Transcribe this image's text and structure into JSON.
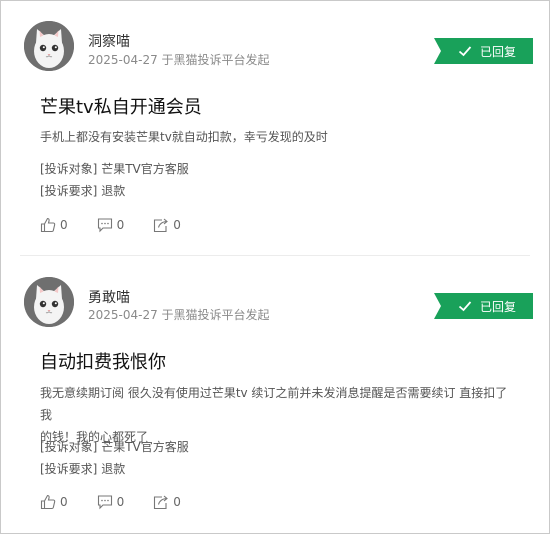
{
  "posts": [
    {
      "user": "洞察喵",
      "meta": "2025-04-27 于黑猫投诉平台发起",
      "status": "已回复",
      "title": "芒果tv私自开通会员",
      "description": "手机上都没有安装芒果tv就自动扣款，幸亏发现的及时",
      "target_label": "[投诉对象]",
      "target_value": "芒果TV官方客服",
      "request_label": "[投诉要求]",
      "request_value": "退款",
      "likes": "0",
      "comments": "0",
      "shares": "0"
    },
    {
      "user": "勇敢喵",
      "meta": "2025-04-27 于黑猫投诉平台发起",
      "status": "已回复",
      "title": "自动扣费我恨你",
      "description_line1": "我无意续期订阅 很久没有使用过芒果tv 续订之前并未发消息提醒是否需要续订 直接扣了我",
      "description_line2": "的钱！我的心都死了",
      "target_label": "[投诉对象]",
      "target_value": "芒果TV官方客服",
      "request_label": "[投诉要求]",
      "request_value": "退款",
      "likes": "0",
      "comments": "0",
      "shares": "0"
    }
  ],
  "icons": {
    "avatar": "cat-avatar-icon",
    "status": "check-icon",
    "like": "thumbs-up-icon",
    "comment": "comment-icon",
    "share": "share-icon"
  },
  "colors": {
    "status_bg": "#19a15a",
    "avatar_bg": "#6f6f6f"
  }
}
